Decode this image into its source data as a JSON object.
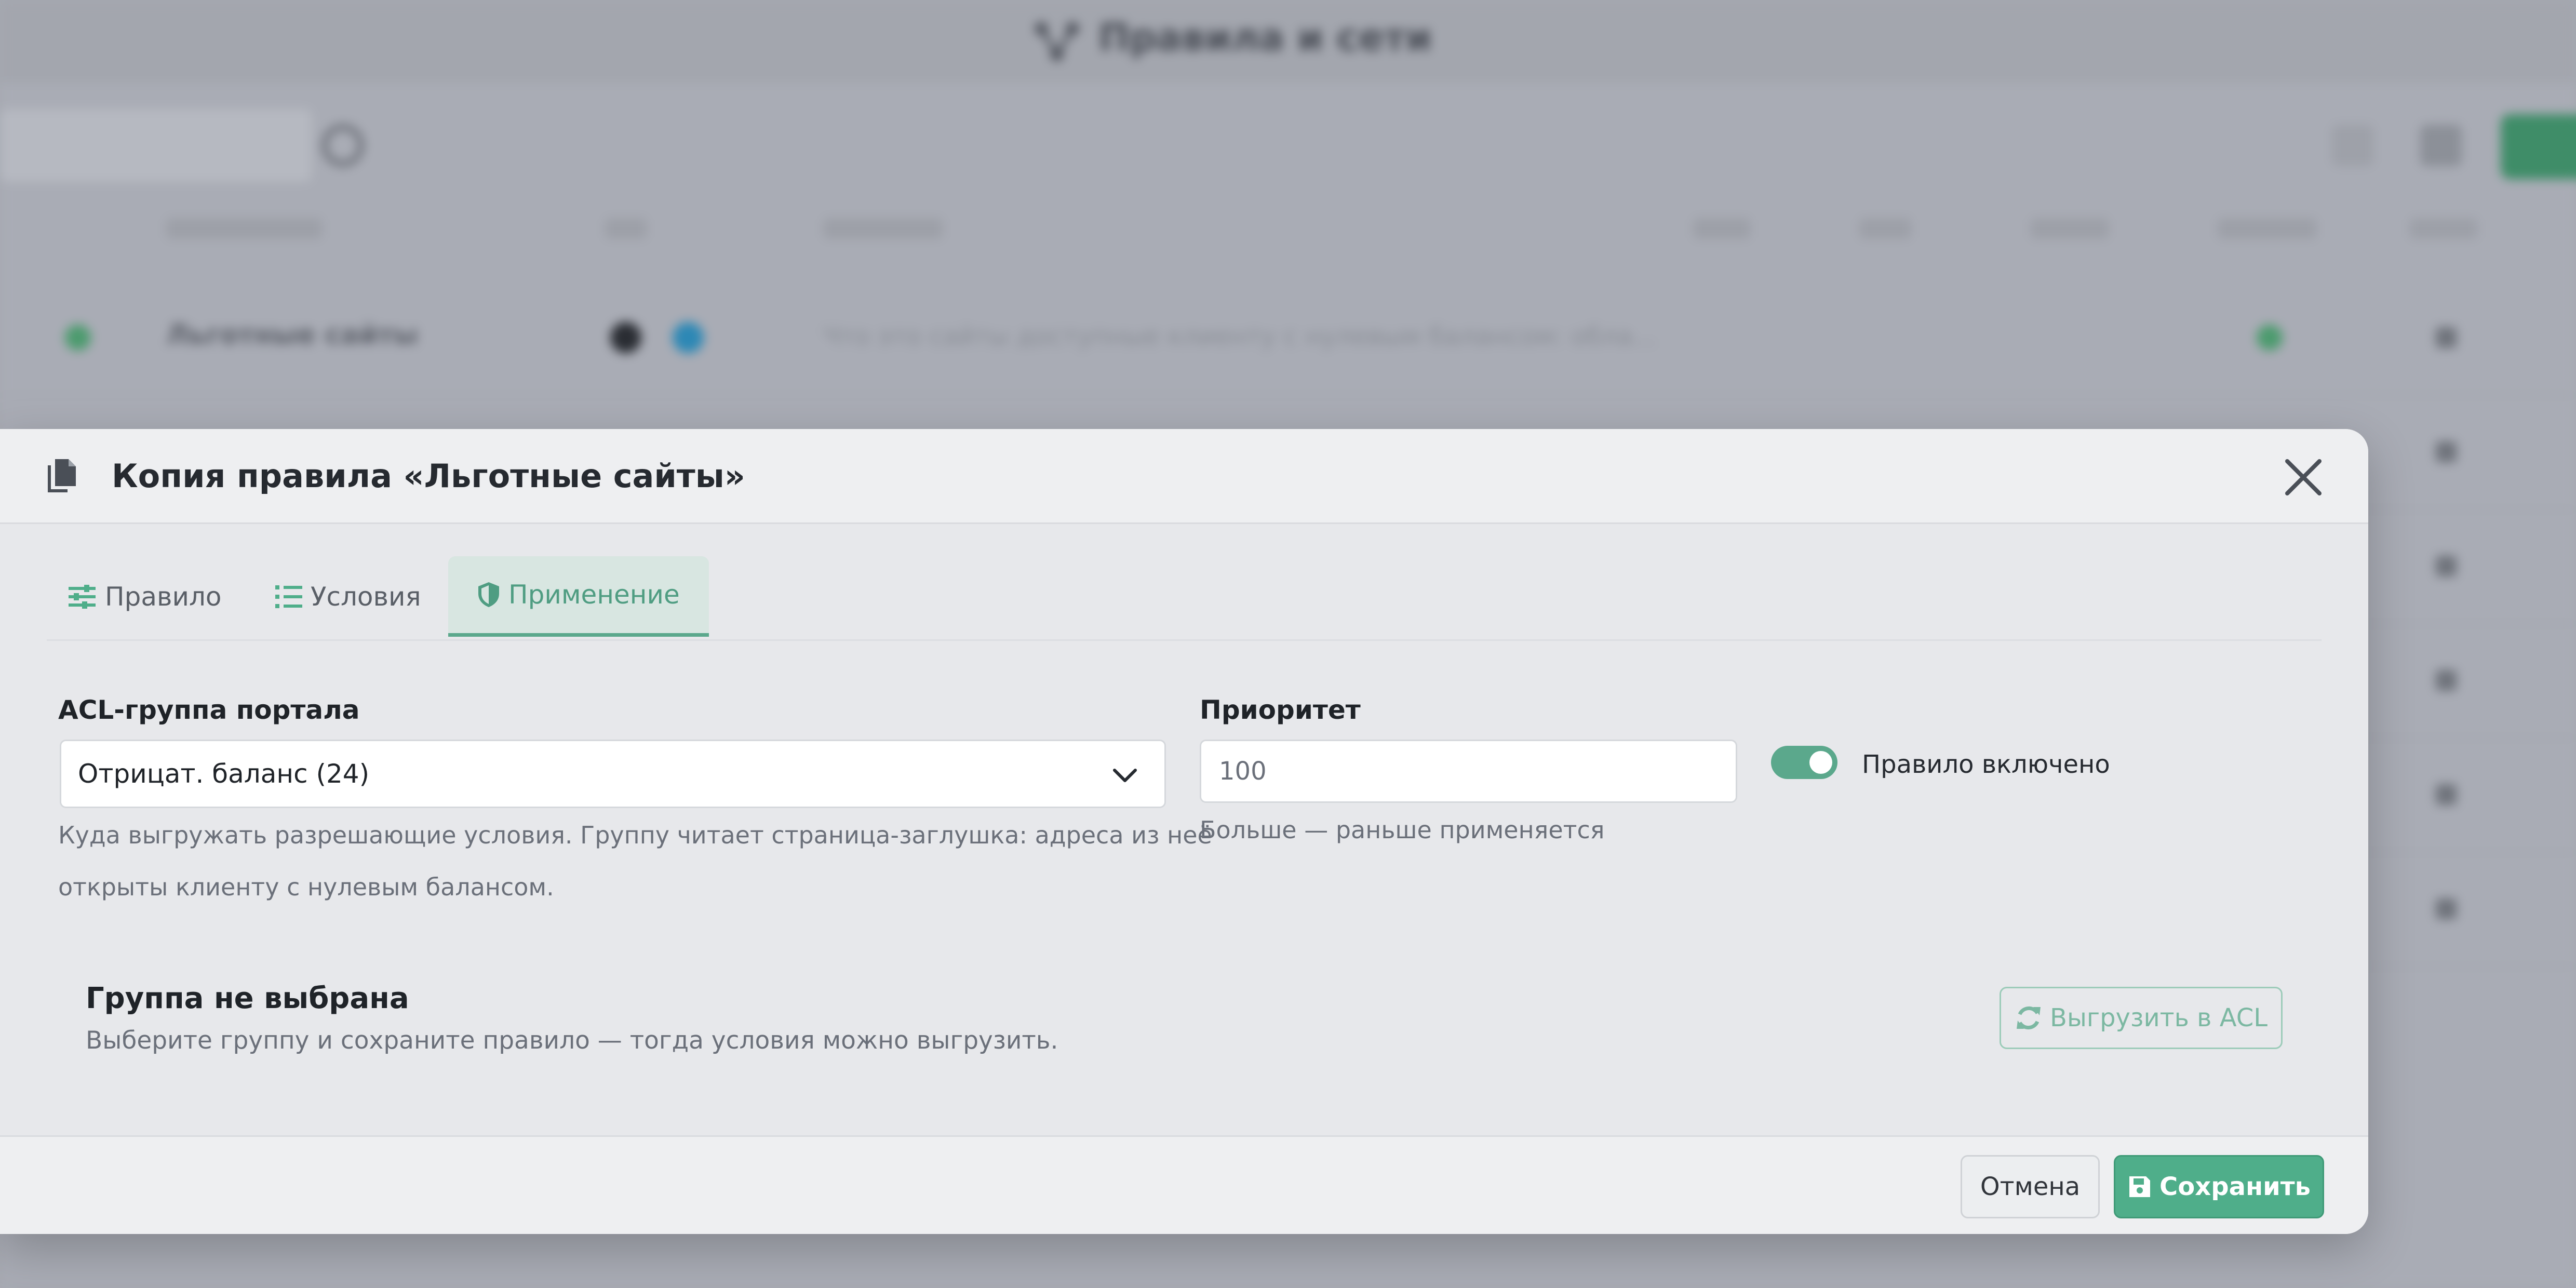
{
  "background": {
    "page_title": "Правила и сети",
    "row_first_name": "Льготные сайты",
    "row_first_desc": "Что это сайты доступные клиенту с нулевым балансом: обла..."
  },
  "modal": {
    "title": "Копия правила «Льготные сайты»",
    "tabs": [
      {
        "label": "Правило",
        "icon": "sliders-icon"
      },
      {
        "label": "Условия",
        "icon": "list-icon"
      },
      {
        "label": "Применение",
        "icon": "shield-icon"
      }
    ],
    "active_tab": "Применение",
    "acl": {
      "label": "ACL-группа портала",
      "selected": "Отрицат. баланс (24)",
      "help_line1": "Куда выгружать разрешающие условия. Группу читает страница-заглушка: адреса из неё",
      "help_line2": "открыты клиенту с нулевым балансом."
    },
    "priority": {
      "label": "Приоритет",
      "value": "100",
      "help": "Больше — раньше применяется"
    },
    "enabled": {
      "label": "Правило включено",
      "checked": true
    },
    "empty_state": {
      "title": "Группа не выбрана",
      "description": "Выберите группу и сохраните правило — тогда условия можно выгрузить.",
      "export_label": "Выгрузить в ACL"
    },
    "footer": {
      "cancel_label": "Отмена",
      "save_label": "Сохранить"
    }
  },
  "colors": {
    "accent": "#4fae8a",
    "accent_light": "#d8e6e1",
    "text": "#1f2328",
    "muted": "#6b707a"
  }
}
